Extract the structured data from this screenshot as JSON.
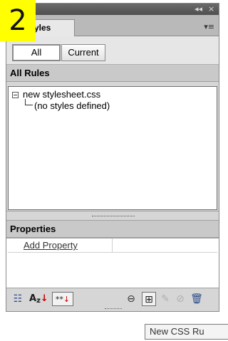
{
  "badge": "2",
  "panel": {
    "tab_label": "tyles",
    "title_controls": {
      "collapse": "◂◂",
      "close": "×"
    },
    "menu_icon": "▾≡",
    "buttons": {
      "all": "All",
      "current": "Current"
    }
  },
  "all_rules": {
    "header": "All Rules",
    "stylesheet": "new stylesheet.css",
    "empty_note": "(no styles defined)"
  },
  "properties": {
    "header": "Properties",
    "add_property": "Add Property"
  },
  "toolbar_icons": [
    "category-view-icon",
    "alpha-sort-icon",
    "set-properties-icon",
    "attach-stylesheet-icon",
    "new-css-rule-icon",
    "edit-style-icon",
    "disable-icon",
    "delete-icon"
  ],
  "tooltip": "New CSS Ru"
}
